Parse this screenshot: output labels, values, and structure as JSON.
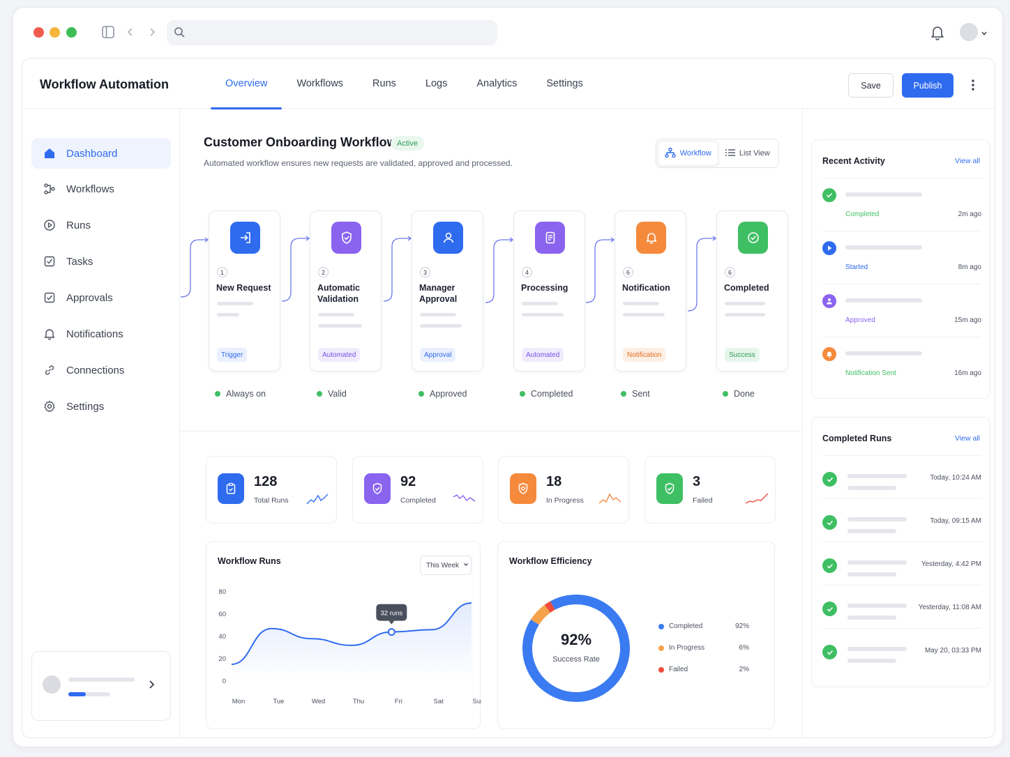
{
  "app": {
    "title": "Workflow Automation"
  },
  "tabs": [
    "Overview",
    "Workflows",
    "Runs",
    "Logs",
    "Analytics",
    "Settings"
  ],
  "actions": {
    "save": "Save",
    "publish": "Publish"
  },
  "sidebar": {
    "items": [
      {
        "label": "Dashboard",
        "icon": "home-icon"
      },
      {
        "label": "Workflows",
        "icon": "workflow-icon"
      },
      {
        "label": "Runs",
        "icon": "play-circle-icon"
      },
      {
        "label": "Tasks",
        "icon": "task-check-icon"
      },
      {
        "label": "Approvals",
        "icon": "approval-check-icon"
      },
      {
        "label": "Notifications",
        "icon": "bell-icon"
      },
      {
        "label": "Connections",
        "icon": "link-icon"
      },
      {
        "label": "Settings",
        "icon": "gear-icon"
      }
    ]
  },
  "workflow": {
    "title": "Customer Onboarding Workflow",
    "status": "Active",
    "description": "Automated workflow ensures new requests are validated, approved and processed.",
    "views": [
      "Workflow",
      "List View"
    ],
    "steps": [
      {
        "num": "1",
        "name": "New Request",
        "tag": "Trigger",
        "status": "Always on",
        "color": "#2f6bef",
        "icon": "login-icon"
      },
      {
        "num": "2",
        "name": "Automatic Validation",
        "tag": "Automated",
        "status": "Valid",
        "color": "#8a63ef",
        "icon": "shield-check-icon"
      },
      {
        "num": "3",
        "name": "Manager Approval",
        "tag": "Approval",
        "status": "Approved",
        "color": "#2f6bef",
        "icon": "user-icon"
      },
      {
        "num": "4",
        "name": "Processing",
        "tag": "Automated",
        "status": "Completed",
        "color": "#8a63ef",
        "icon": "document-icon"
      },
      {
        "num": "6",
        "name": "Notification",
        "tag": "Notification",
        "status": "Sent",
        "color": "#f58a3c",
        "icon": "bell-icon"
      },
      {
        "num": "6",
        "name": "Completed",
        "tag": "Success",
        "status": "Done",
        "color": "#3fbf63",
        "icon": "check-circle-icon"
      }
    ]
  },
  "stats": [
    {
      "value": "128",
      "label": "Total Runs",
      "color": "#2f6bef",
      "spark": "#2f6bef",
      "icon": "clipboard-icon"
    },
    {
      "value": "92",
      "label": "Completed",
      "color": "#8a63ef",
      "spark": "#8a63ef",
      "icon": "shield-check-icon"
    },
    {
      "value": "18",
      "label": "In Progress",
      "color": "#f58a3c",
      "spark": "#f58a3c",
      "icon": "shield-icon"
    },
    {
      "value": "3",
      "label": "Failed",
      "color": "#3fbf63",
      "spark": "#ef4b3d",
      "icon": "check-shield-icon"
    }
  ],
  "runs_chart": {
    "title": "Workflow Runs",
    "range": "This Week",
    "tooltip": "32 runs"
  },
  "efficiency": {
    "title": "Workflow Efficiency",
    "center_value": "92%",
    "center_label": "Success Rate"
  },
  "chart_data": [
    {
      "type": "line",
      "title": "Workflow Runs",
      "categories": [
        "Mon",
        "Tue",
        "Wed",
        "Thu",
        "Fri",
        "Sat",
        "Sun"
      ],
      "values": [
        15,
        47,
        38,
        32,
        44,
        46,
        70
      ],
      "yticks": [
        0,
        20,
        40,
        60,
        80
      ],
      "ylim": [
        0,
        80
      ],
      "highlight": {
        "category": "Fri",
        "label": "32 runs"
      },
      "color": "#2f6bef"
    },
    {
      "type": "pie",
      "title": "Workflow Efficiency",
      "labels": [
        "Completed",
        "In Progress",
        "Failed"
      ],
      "values": [
        92,
        6,
        2
      ],
      "display": [
        "92%",
        "6%",
        "2%"
      ],
      "colors": [
        "#3b7bf2",
        "#f5a34a",
        "#ef4b3d"
      ]
    }
  ],
  "activity": {
    "title": "Recent Activity",
    "view_all": "View all",
    "items": [
      {
        "status": "Completed",
        "time": "2m ago",
        "color": "#3fbf63",
        "icon": "check-icon"
      },
      {
        "status": "Started",
        "time": "8m ago",
        "color": "#2f6bef",
        "icon": "play-icon"
      },
      {
        "status": "Approved",
        "time": "15m ago",
        "color": "#8a63ef",
        "icon": "user-icon"
      },
      {
        "status": "Notification Sent",
        "time": "16m ago",
        "color": "#f58a3c",
        "icon": "bell-icon"
      }
    ]
  },
  "completed_runs": {
    "title": "Completed Runs",
    "view_all": "View all",
    "items": [
      {
        "time": "Today, 10:24 AM"
      },
      {
        "time": "Today, 09:15 AM"
      },
      {
        "time": "Yesterday, 4:42 PM"
      },
      {
        "time": "Yesterday, 11:08 AM"
      },
      {
        "time": "May 20, 03:33 PM"
      }
    ]
  }
}
